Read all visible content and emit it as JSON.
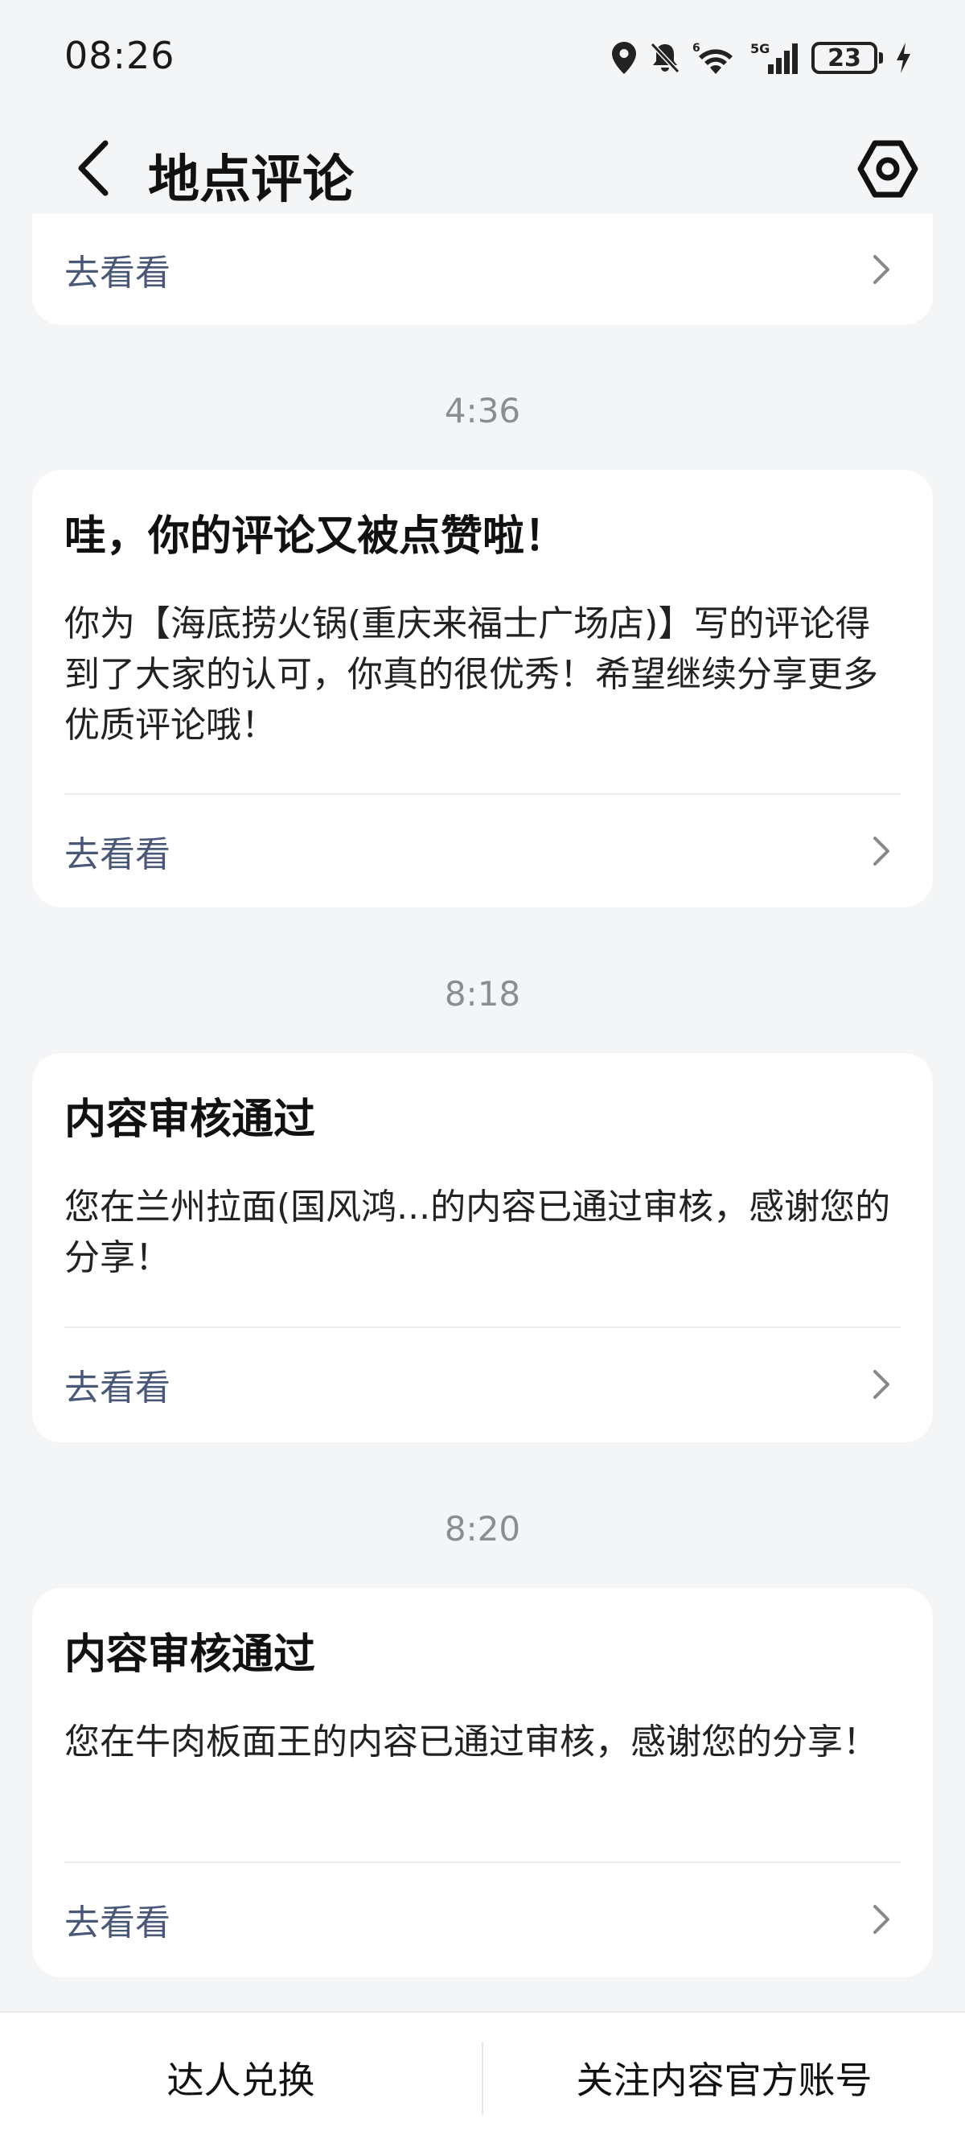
{
  "status_bar": {
    "time": "08:26",
    "battery": "23",
    "icons": [
      "location-icon",
      "mute-icon",
      "wifi-icon",
      "signal-5g-icon",
      "battery-icon",
      "charging-icon"
    ]
  },
  "header": {
    "title": "地点评论",
    "back_icon": "chevron-left-icon",
    "settings_icon": "settings-icon"
  },
  "top_card": {
    "action_label": "去看看"
  },
  "messages": [
    {
      "time": "4:36",
      "title": "哇，你的评论又被点赞啦！",
      "body": "你为【海底捞火锅(重庆来福士广场店)】写的评论得到了大家的认可，你真的很优秀！希望继续分享更多优质评论哦！",
      "action_label": "去看看"
    },
    {
      "time": "8:18",
      "title": "内容审核通过",
      "body": "您在兰州拉面(国风鸿...的内容已通过审核，感谢您的分享！",
      "action_label": "去看看"
    },
    {
      "time": "8:20",
      "title": "内容审核通过",
      "body": "您在牛肉板面王的内容已通过审核，感谢您的分享！",
      "action_label": "去看看"
    }
  ],
  "bottom_bar": {
    "left_label": "达人兑换",
    "right_label": "关注内容官方账号"
  },
  "colors": {
    "background": "#f4f5f7",
    "card": "#ffffff",
    "action_text": "#4a5878",
    "time_text": "#8a8d93"
  }
}
